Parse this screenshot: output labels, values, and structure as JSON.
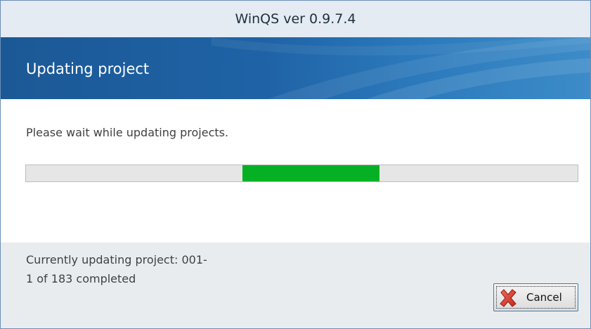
{
  "window": {
    "title": "WinQS ver 0.9.7.4"
  },
  "banner": {
    "title": "Updating project"
  },
  "content": {
    "message": "Please wait while updating projects."
  },
  "progress": {
    "style": "marquee",
    "color": "#06b025",
    "track_color": "#e6e6e6"
  },
  "footer": {
    "status_line": "Currently updating project: 001-",
    "count_line": "1 of 183 completed"
  },
  "buttons": {
    "cancel_label": "Cancel",
    "cancel_icon": "red-x-icon"
  },
  "colors": {
    "banner_dark": "#1b5896",
    "banner_light": "#3d8cc9",
    "footer_bg": "#e9ecef"
  }
}
